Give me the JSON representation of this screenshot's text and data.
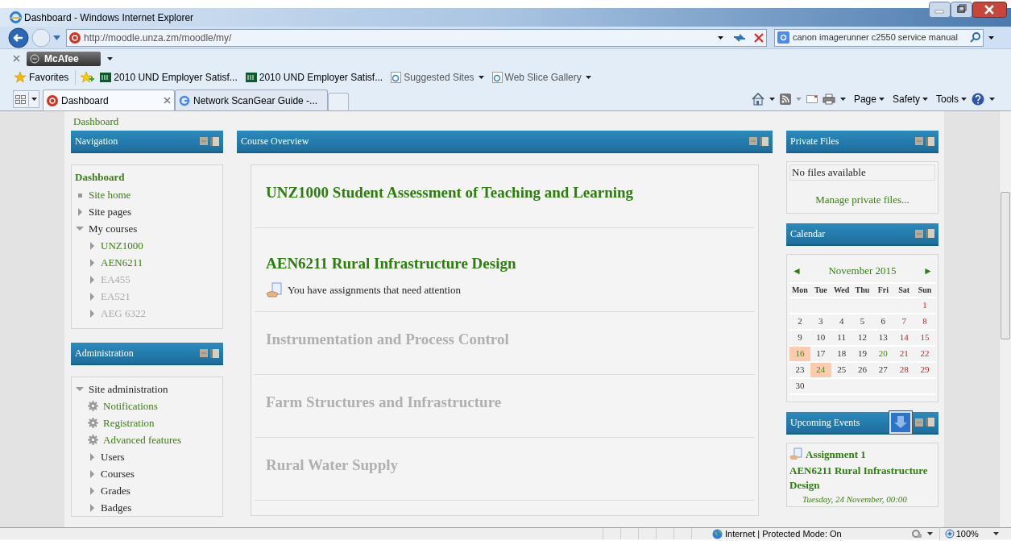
{
  "window": {
    "title": "Dashboard - Windows Internet Explorer"
  },
  "address_bar": {
    "url": "http://moodle.unza.zm/moodle/my/"
  },
  "search": {
    "value": "canon imagerunner c2550 service manual"
  },
  "addon_bar": {
    "label": "McAfee"
  },
  "favorites_bar": {
    "favorites": "Favorites",
    "items": [
      {
        "label": "2010 UND Employer Satisf...",
        "kind": "site"
      },
      {
        "label": "2010 UND Employer Satisf...",
        "kind": "site"
      },
      {
        "label": "Suggested Sites",
        "kind": "ie"
      },
      {
        "label": "Web Slice Gallery",
        "kind": "ie"
      }
    ]
  },
  "tabs": [
    {
      "label": "Dashboard",
      "selected": true
    },
    {
      "label": "Network ScanGear Guide -...",
      "selected": false
    }
  ],
  "commands": [
    "Page",
    "Safety",
    "Tools"
  ],
  "breadcrumb": "Dashboard",
  "navigation": {
    "title": "Navigation",
    "heading": "Dashboard",
    "items": [
      {
        "label": "Site home",
        "kind": "page"
      },
      {
        "label": "Site pages",
        "kind": "category",
        "expanded": false
      },
      {
        "label": "My courses",
        "kind": "category",
        "expanded": true,
        "children": [
          {
            "label": "UNZ1000",
            "kind": "course",
            "expanded": false,
            "dimmed": false
          },
          {
            "label": "AEN6211",
            "kind": "course",
            "expanded": false,
            "dimmed": false
          },
          {
            "label": "EA455",
            "kind": "course",
            "expanded": false,
            "dimmed": true
          },
          {
            "label": "EA521",
            "kind": "course",
            "expanded": false,
            "dimmed": true
          },
          {
            "label": "AEG 6322",
            "kind": "course",
            "expanded": false,
            "dimmed": true
          }
        ]
      }
    ]
  },
  "administration": {
    "title": "Administration",
    "items": [
      {
        "label": "Site administration",
        "kind": "category",
        "expanded": true,
        "children": [
          {
            "label": "Notifications",
            "kind": "setting"
          },
          {
            "label": "Registration",
            "kind": "setting"
          },
          {
            "label": "Advanced features",
            "kind": "setting"
          },
          {
            "label": "Users",
            "kind": "category",
            "expanded": false
          },
          {
            "label": "Courses",
            "kind": "category",
            "expanded": false
          },
          {
            "label": "Grades",
            "kind": "category",
            "expanded": false
          },
          {
            "label": "Badges",
            "kind": "category",
            "expanded": false
          }
        ]
      }
    ]
  },
  "course_overview": {
    "title": "Course Overview",
    "courses": [
      {
        "title": "UNZ1000 Student Assessment of Teaching and Learning",
        "dimmed": false
      },
      {
        "title": "AEN6211 Rural Infrastructure Design",
        "dimmed": false,
        "notice": "You have assignments that need attention"
      },
      {
        "title": "Instrumentation and Process Control",
        "dimmed": true
      },
      {
        "title": "Farm Structures and Infrastructure",
        "dimmed": true
      },
      {
        "title": "Rural Water Supply",
        "dimmed": true
      }
    ]
  },
  "private_files": {
    "title": "Private Files",
    "message": "No files available",
    "link": "Manage private files..."
  },
  "calendar": {
    "title": "Calendar",
    "prev": "◄",
    "next": "►",
    "month": "November 2015",
    "weekdays": [
      "Mon",
      "Tue",
      "Wed",
      "Thu",
      "Fri",
      "Sat",
      "Sun"
    ],
    "weeks": [
      [
        {
          "day": "1",
          "kind": "weekend",
          "highlighted": false
        }
      ],
      [
        {
          "day": "2",
          "kind": "weekday",
          "highlighted": false
        },
        {
          "day": "3",
          "kind": "weekday",
          "highlighted": false
        },
        {
          "day": "4",
          "kind": "weekday",
          "highlighted": false
        },
        {
          "day": "5",
          "kind": "weekday",
          "highlighted": false
        },
        {
          "day": "6",
          "kind": "weekday",
          "highlighted": false
        },
        {
          "day": "7",
          "kind": "weekend",
          "highlighted": false
        },
        {
          "day": "8",
          "kind": "weekend",
          "highlighted": false
        }
      ],
      [
        {
          "day": "9",
          "kind": "weekday",
          "highlighted": false
        },
        {
          "day": "10",
          "kind": "weekday",
          "highlighted": false
        },
        {
          "day": "11",
          "kind": "weekday",
          "highlighted": false
        },
        {
          "day": "12",
          "kind": "weekday",
          "highlighted": false
        },
        {
          "day": "13",
          "kind": "weekday",
          "highlighted": false
        },
        {
          "day": "14",
          "kind": "weekend",
          "highlighted": false
        },
        {
          "day": "15",
          "kind": "weekend",
          "highlighted": false
        }
      ],
      [
        {
          "day": "16",
          "kind": "event",
          "highlighted": true
        },
        {
          "day": "17",
          "kind": "weekday",
          "highlighted": false
        },
        {
          "day": "18",
          "kind": "weekday",
          "highlighted": false
        },
        {
          "day": "19",
          "kind": "weekday",
          "highlighted": false
        },
        {
          "day": "20",
          "kind": "event",
          "highlighted": false
        },
        {
          "day": "21",
          "kind": "weekend",
          "highlighted": false
        },
        {
          "day": "22",
          "kind": "weekend",
          "highlighted": false
        }
      ],
      [
        {
          "day": "23",
          "kind": "weekday",
          "highlighted": false
        },
        {
          "day": "24",
          "kind": "event",
          "highlighted": true
        },
        {
          "day": "25",
          "kind": "weekday",
          "highlighted": false
        },
        {
          "day": "26",
          "kind": "weekday",
          "highlighted": false
        },
        {
          "day": "27",
          "kind": "weekday",
          "highlighted": false
        },
        {
          "day": "28",
          "kind": "weekend",
          "highlighted": false
        },
        {
          "day": "29",
          "kind": "weekend",
          "highlighted": false
        }
      ],
      [
        {
          "day": "30",
          "kind": "weekday",
          "highlighted": false
        }
      ]
    ]
  },
  "upcoming_events": {
    "title": "Upcoming Events",
    "events": [
      {
        "name": "Assignment 1",
        "course": "AEN6211 Rural Infrastructure Design",
        "date": "Tuesday, 24 November, 00:00"
      }
    ]
  },
  "status_bar": {
    "zone": "Internet | Protected Mode: On",
    "zoom": "100%"
  }
}
